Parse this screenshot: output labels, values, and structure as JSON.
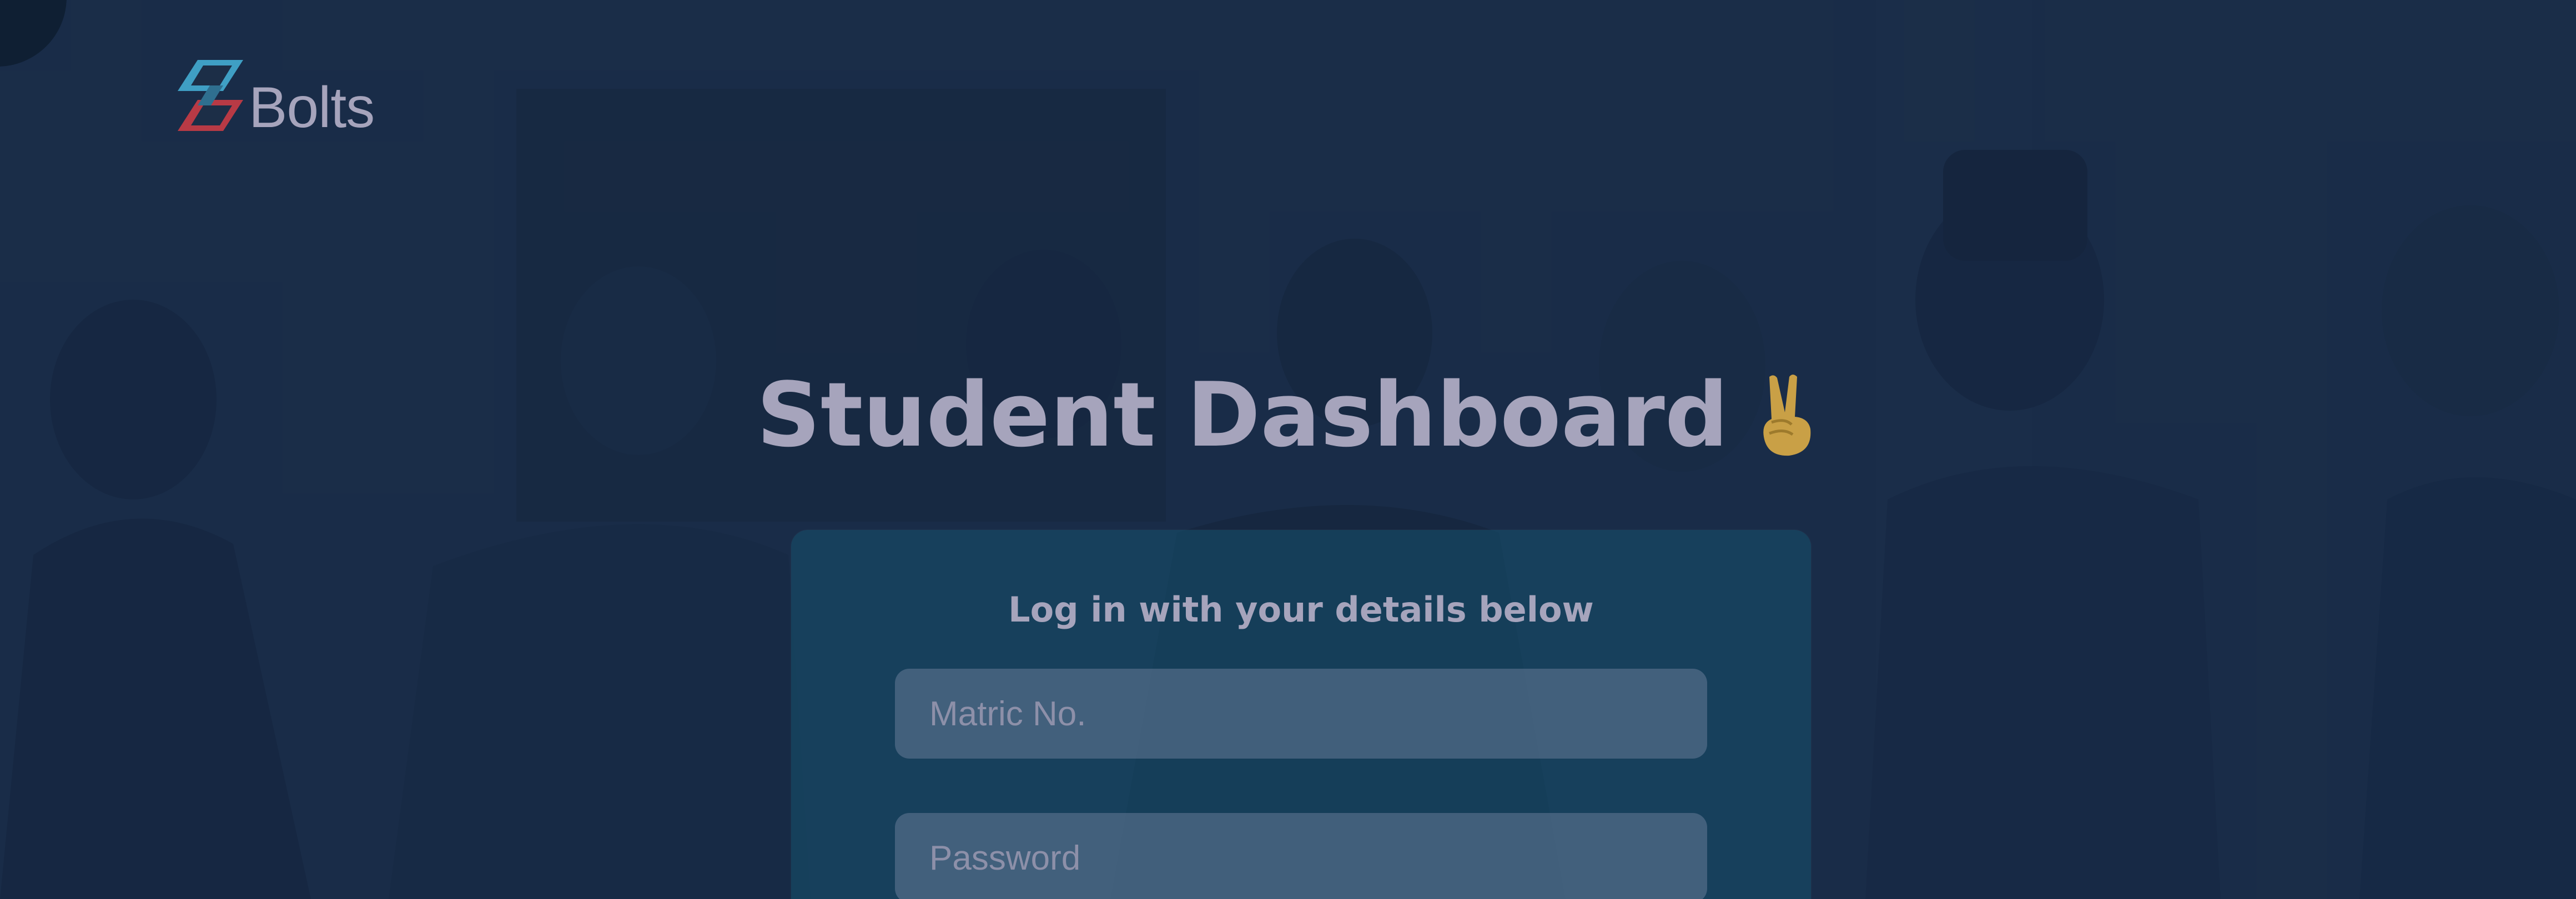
{
  "brand": {
    "name": "Bolts",
    "logo_colors": {
      "top": "#3f9fc4",
      "bottom": "#b83a45"
    }
  },
  "page_title": "Student Dashboard",
  "title_emoji": "victory-hand",
  "login_card": {
    "heading": "Log in with your details below",
    "matric_placeholder": "Matric No.",
    "matric_value": "",
    "password_placeholder": "Password",
    "password_value": ""
  },
  "colors": {
    "background_overlay": "#1a2b44",
    "text_primary": "#a6a4bc",
    "card_background": "#16526e"
  }
}
